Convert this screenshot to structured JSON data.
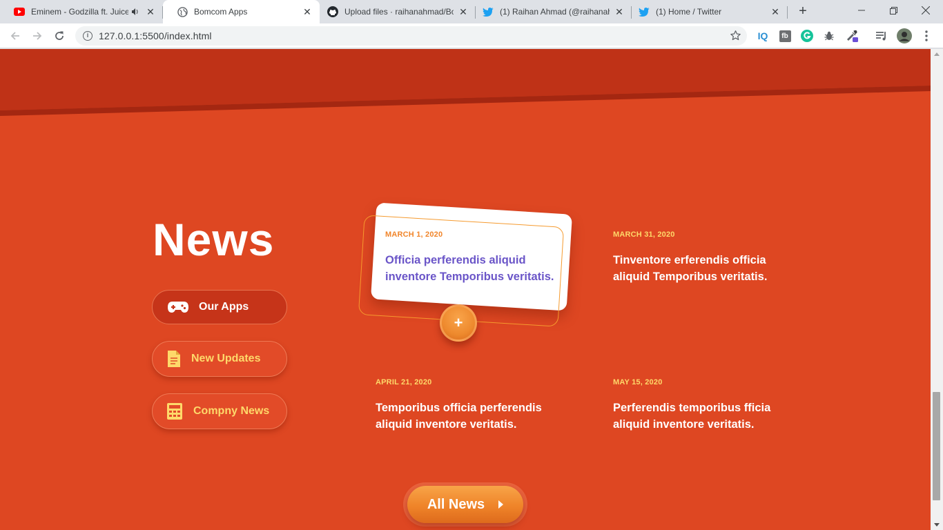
{
  "browser": {
    "tabs": [
      {
        "title": "Eminem - Godzilla ft. Juice",
        "icon": "youtube-icon",
        "audio": true
      },
      {
        "title": "Bomcom Apps",
        "icon": "globe-icon",
        "active": true
      },
      {
        "title": "Upload files · raihanahmad/Bo",
        "icon": "github-icon"
      },
      {
        "title": "(1) Raihan Ahmad (@raihanah",
        "icon": "twitter-icon"
      },
      {
        "title": "(1) Home / Twitter",
        "icon": "twitter-icon"
      }
    ],
    "url": "127.0.0.1:5500/index.html",
    "colors": {
      "youtube": "#ff0000",
      "twitter": "#1da1f2",
      "grammarly": "#15c39a"
    }
  },
  "page": {
    "heading": "News",
    "side_buttons": [
      {
        "label": "Our Apps",
        "icon": "gamepad-icon"
      },
      {
        "label": "New Updates",
        "icon": "document-icon"
      },
      {
        "label": "Compny News",
        "icon": "calculator-icon"
      }
    ],
    "news": [
      {
        "date": "MARCH 1, 2020",
        "text": "Officia perferendis aliquid inventore Temporibus veritatis."
      },
      {
        "date": "MARCH 31, 2020",
        "text": "Tinventore erferendis officia aliquid Temporibus veritatis."
      },
      {
        "date": "APRIL 21, 2020",
        "text": "Temporibus officia perferendis aliquid inventore veritatis."
      },
      {
        "date": "MAY 15, 2020",
        "text": "Perferendis temporibus fficia aliquid inventore veritatis."
      }
    ],
    "plus_label": "+",
    "all_news_label": "All News",
    "colors": {
      "background": "#de4722",
      "band": "#c13318",
      "accent_yellow": "#fed96a",
      "accent_orange": "#f1852a",
      "card_text": "#6a55c8"
    }
  }
}
